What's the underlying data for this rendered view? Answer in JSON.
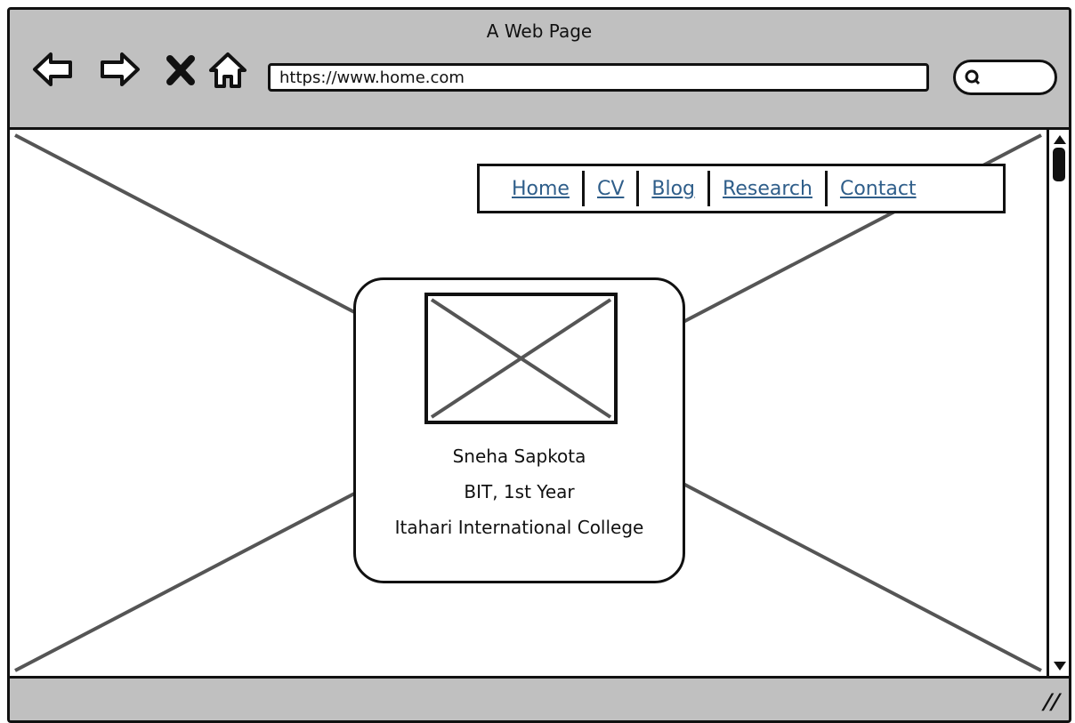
{
  "window": {
    "title": "A Web Page"
  },
  "toolbar": {
    "url": "https://www.home.com",
    "buttons": [
      "back-icon",
      "forward-icon",
      "stop-icon",
      "home-icon"
    ],
    "search_icon": "search-icon"
  },
  "navbar": {
    "items": [
      {
        "label": "Home"
      },
      {
        "label": "CV"
      },
      {
        "label": "Blog"
      },
      {
        "label": "Research"
      },
      {
        "label": "Contact"
      }
    ],
    "link_color": "#2f5e8a"
  },
  "profile": {
    "image_icon": "image-placeholder-icon",
    "name": "Sneha Sapkota",
    "program": "BIT, 1st Year",
    "college": "Itahari International College"
  },
  "colors": {
    "chrome": "#c0c0c0",
    "stroke": "#111111",
    "placeholder_lines": "#555555"
  }
}
